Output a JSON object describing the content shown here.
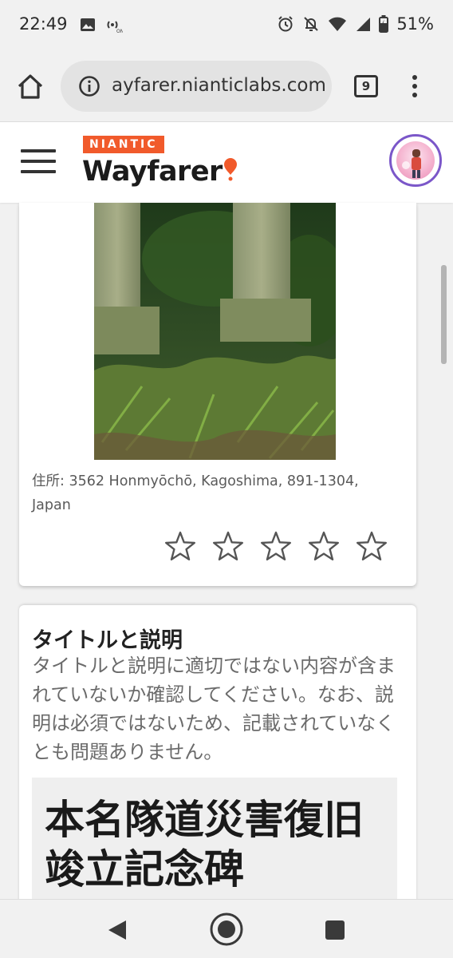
{
  "status_bar": {
    "time": "22:49",
    "battery_percent": "51%",
    "left_icons": [
      "image-icon",
      "hotspot-icon"
    ],
    "right_icons": [
      "alarm-icon",
      "notifications-off-icon",
      "wifi-icon",
      "signal-icon",
      "battery-icon"
    ]
  },
  "browser": {
    "url": "ayfarer.nianticlabs.com",
    "tab_count": "9",
    "icons": [
      "home-icon",
      "info-icon",
      "tabs-icon",
      "more-vert-icon"
    ]
  },
  "header": {
    "brand_badge": "NIANTIC",
    "logo_text": "Wayfarer",
    "brand_color": "#f15a2b",
    "avatar_ring_color": "#7b57c9"
  },
  "nomination": {
    "address": "住所: 3562 Honmyōchō, Kagoshima, 891-1304, Japan",
    "star_rating": {
      "max": 5,
      "selected": 0
    }
  },
  "title_section": {
    "heading": "タイトルと説明",
    "description": "タイトルと説明に適切ではない内容が含まれていないか確認してください。なお、説明は必須ではないため、記載されていなくとも問題ありません。",
    "nomination_title": "本名隊道災害復旧竣立記念碑"
  },
  "nav_bar": {
    "icons": [
      "back-icon",
      "home-circle-icon",
      "recent-apps-icon"
    ]
  }
}
